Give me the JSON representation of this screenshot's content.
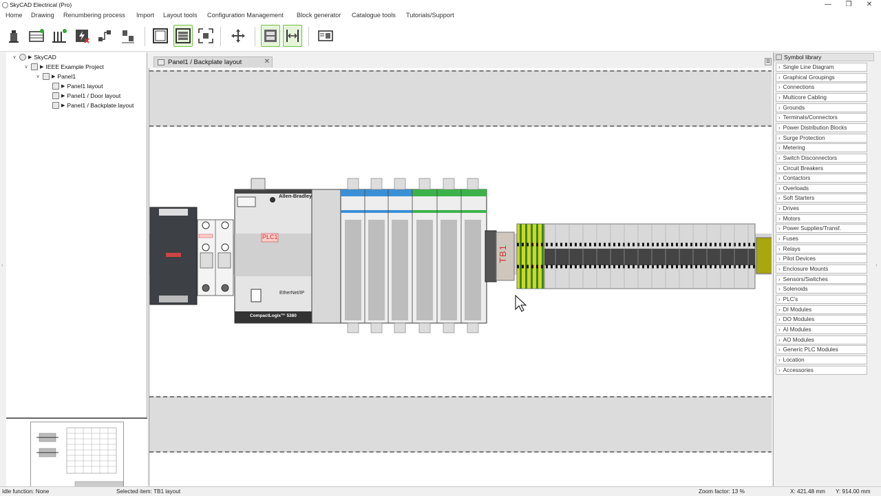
{
  "window": {
    "title": "SkyCAD Electrical (Pro)",
    "controls": {
      "minimize": "—",
      "maximize": "❐",
      "close": "✕"
    }
  },
  "menu": [
    "Home",
    "Drawing",
    "Renumbering process",
    "Import",
    "Layout tools",
    "Configuration Management",
    "Block generator",
    "Catalogue tools",
    "Tutorials/Support"
  ],
  "toolbar": {
    "buttons": [
      {
        "name": "insert-component-icon",
        "active": false
      },
      {
        "name": "add-panel-icon",
        "active": false
      },
      {
        "name": "add-rail-icon",
        "active": false
      },
      {
        "name": "electrical-check-icon",
        "active": false
      },
      {
        "name": "connect-wire-icon",
        "active": false
      },
      {
        "name": "move-parts-icon",
        "active": false
      },
      {
        "name": "frame-view-icon",
        "active": false
      },
      {
        "name": "backplate-view-icon",
        "active": true
      },
      {
        "name": "zoom-fit-icon",
        "active": false
      },
      {
        "name": "move-canvas-icon",
        "active": false
      },
      {
        "name": "snap-rail-icon",
        "active": true
      },
      {
        "name": "dimension-icon",
        "active": true
      },
      {
        "name": "report-icon",
        "active": false
      }
    ]
  },
  "tree": {
    "items": [
      {
        "label": "SkyCAD",
        "level": 0
      },
      {
        "label": "IEEE Example Project",
        "level": 1
      },
      {
        "label": "Panel1",
        "level": 2
      },
      {
        "label": "Panel1 layout",
        "level": 3
      },
      {
        "label": "Panel1 / Door layout",
        "level": 3
      },
      {
        "label": "Panel1 / Backplate layout",
        "level": 3
      }
    ]
  },
  "document": {
    "tab_label": "Panel1 / Backplate layout",
    "close": "✕",
    "menu": "☰"
  },
  "drawing": {
    "plc_label": "PLC1",
    "brand": "Allen-Bradley",
    "ethernet": "EtherNet/IP",
    "model": "CompactLogix™ 5380",
    "terminal_label": "TB1"
  },
  "library": {
    "header": "Symbol library",
    "items": [
      "Single Line Diagram",
      "Graphical Groupings",
      "Connections",
      "Multicore Cabling",
      "Grounds",
      "Terminals/Connectors",
      "Power Distribution Blocks",
      "Surge Protection",
      "Metering",
      "Switch Disconnectors",
      "Circuit Breakers",
      "Contactors",
      "Overloads",
      "Soft Starters",
      "Drives",
      "Motors",
      "Power Supplies/Transf.",
      "Fuses",
      "Relays",
      "Pilot Devices",
      "Enclosure Mounts",
      "Sensors/Switches",
      "Solenoids",
      "PLC's",
      "DI Modules",
      "DO Modules",
      "AI Modules",
      "AO Modules",
      "Generic PLC Modules",
      "Location",
      "Accessories"
    ]
  },
  "status": {
    "function": "Idle function: None",
    "selected": "Selected item: TB1 layout",
    "zoom": "Zoom factor: 13 %",
    "x": "X: 421.48 mm",
    "y": "Y: 914.00 mm"
  },
  "colors": {
    "accent": "#6fbf3f",
    "io_blue": "#3a8fd6",
    "io_green": "#3cb34a",
    "ground_yellow": "#d6d41e",
    "ground_green": "#2e8b2e"
  }
}
